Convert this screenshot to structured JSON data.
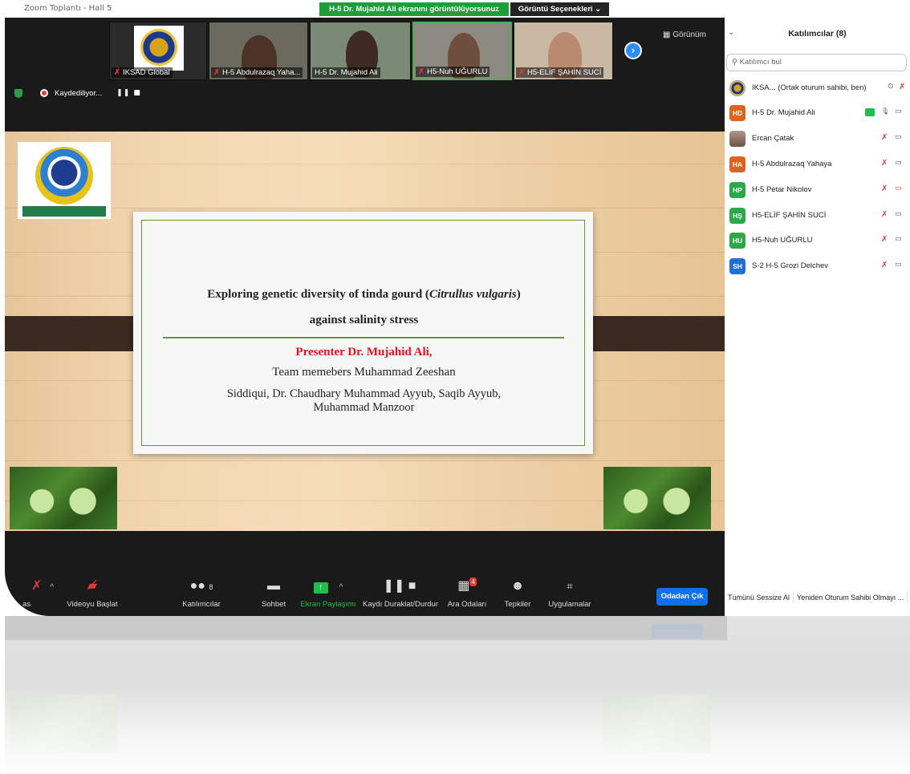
{
  "window": {
    "title": "Zoom Toplantı - Hall 5",
    "share_banner": "H-5 Dr. Mujahid Ali ekranını görüntülüyorsunuz",
    "view_options": "Görüntü Seçenekleri ⌄",
    "view_button": "Görünüm"
  },
  "thumbnails": [
    {
      "label": "IKSAD Global"
    },
    {
      "label": "H-5 Abdulrazaq Yaha..."
    },
    {
      "label": "H-5 Dr. Mujahid Ali"
    },
    {
      "label": "H5-Nuh UĞURLU"
    },
    {
      "label": "H5-ELİF ŞAHİN SUCİ"
    }
  ],
  "recording": {
    "text": "Kaydediliyor...",
    "controls": "❚❚  ■"
  },
  "slide": {
    "title_line1_a": "Exploring genetic diversity of tinda gourd (",
    "title_line1_italic": "Citrullus vulgaris",
    "title_line1_b": ")",
    "title_line2": "against salinity stress",
    "presenter": "Presenter Dr. Mujahid Ali,",
    "team_line1": "Team memebers  Muhammad Zeeshan",
    "team_line2": "Siddiqui, Dr. Chaudhary Muhammad Ayyub, Saqib Ayyub,",
    "team_line3": "Muhammad Manzoor"
  },
  "toolbar": {
    "mute_label": "as",
    "video_label": "Videoyu Başlat",
    "participants_label": "Katılımcılar",
    "participants_count": "8",
    "chat_label": "Sohbet",
    "share_label": "Ekran Paylaşımı",
    "record_label": "Kaydı Duraklat/Durdur",
    "breakout_label": "Ara Odaları",
    "breakout_badge": "4",
    "reactions_label": "Tepkiler",
    "apps_label": "Uygulamalar",
    "leave_label": "Odadan Çık"
  },
  "panel": {
    "title": "Katılımcılar (8)",
    "search_placeholder": "Katılımcı bul",
    "participants": [
      {
        "initials": "",
        "name": "IKSA...  (Ortak oturum sahibi, ben)",
        "color": "#ffffff"
      },
      {
        "initials": "HD",
        "name": "H-5 Dr. Mujahid Ali",
        "color": "#e0631b"
      },
      {
        "initials": "",
        "name": "Ercan Çatak",
        "color": "#9c7b6b"
      },
      {
        "initials": "HA",
        "name": "H-5 Abdulrazaq Yahaya",
        "color": "#e0631b"
      },
      {
        "initials": "HP",
        "name": "H-5 Petar Nikolov",
        "color": "#2ba84a"
      },
      {
        "initials": "HŞ",
        "name": "H5-ELİF ŞAHİN SUCİ",
        "color": "#2ba84a"
      },
      {
        "initials": "HU",
        "name": "H5-Nuh UĞURLU",
        "color": "#2ba84a"
      },
      {
        "initials": "SH",
        "name": "S-2 H-5 Grozi Delchev",
        "color": "#1e6fd9"
      }
    ],
    "mute_all": "Tümünü Sessize Al",
    "reclaim_host": "Yeniden Oturum Sahibi Olmayı ..."
  }
}
